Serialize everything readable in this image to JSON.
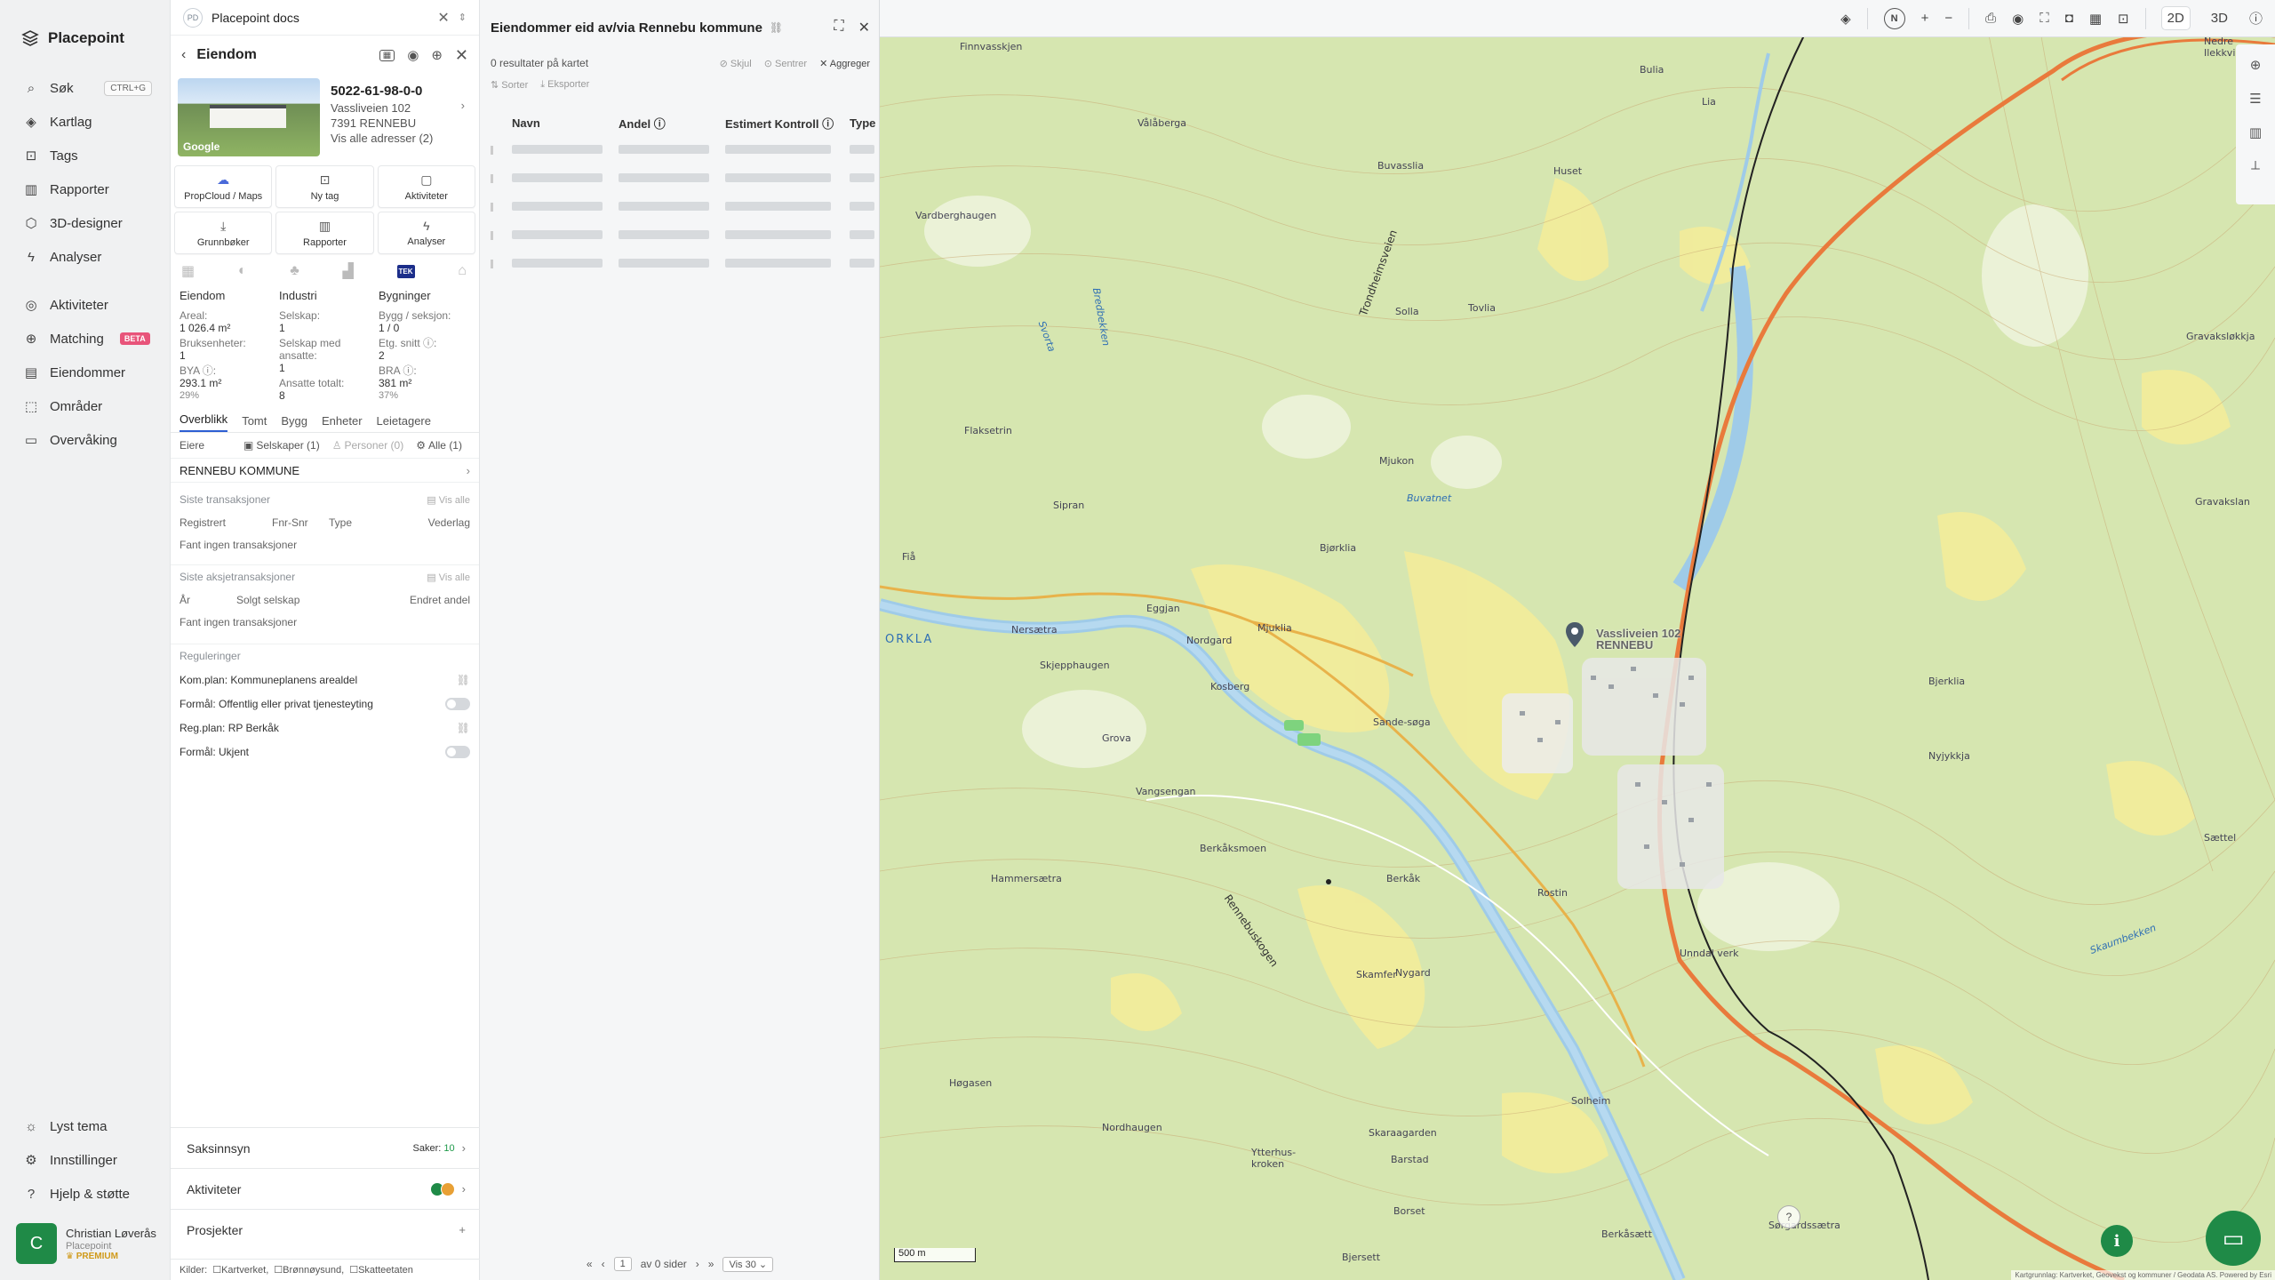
{
  "nav": {
    "brand": "Placepoint",
    "items": [
      {
        "label": "Søk",
        "icon": "search-icon",
        "kbd": "CTRL+G"
      },
      {
        "label": "Kartlag",
        "icon": "layers-icon"
      },
      {
        "label": "Tags",
        "icon": "bookmark-icon"
      },
      {
        "label": "Rapporter",
        "icon": "chart-icon"
      },
      {
        "label": "3D-designer",
        "icon": "cube-icon"
      },
      {
        "label": "Analyser",
        "icon": "bolt-icon"
      },
      {
        "label": "Aktiviteter",
        "icon": "activity-icon"
      },
      {
        "label": "Matching",
        "icon": "match-icon",
        "badge": "BETA"
      },
      {
        "label": "Eiendommer",
        "icon": "building-icon"
      },
      {
        "label": "Områder",
        "icon": "area-icon"
      },
      {
        "label": "Overvåking",
        "icon": "monitor-icon"
      }
    ],
    "bottom": [
      {
        "label": "Lyst tema",
        "icon": "sun-icon"
      },
      {
        "label": "Innstillinger",
        "icon": "gear-icon"
      },
      {
        "label": "Hjelp & støtte",
        "icon": "help-icon"
      }
    ],
    "user": {
      "initial": "C",
      "name": "Christian Løverås",
      "org": "Placepoint",
      "tier": "PREMIUM"
    }
  },
  "panel": {
    "doc_title": "Placepoint docs",
    "doc_badge": "PD",
    "header": "Eiendom",
    "gnr": "5022-61-98-0-0",
    "address": "Vassliveien 102",
    "postal": "7391 RENNEBU",
    "all_addresses": "Vis alle adresser (2)",
    "thumb_logo": "Google",
    "tiles": [
      {
        "label": "PropCloud / Maps",
        "icon": "cloud-icon"
      },
      {
        "label": "Ny tag",
        "icon": "bookmark-icon"
      },
      {
        "label": "Aktiviteter",
        "icon": "chat-icon"
      },
      {
        "label": "Grunnbøker",
        "icon": "download-icon"
      },
      {
        "label": "Rapporter",
        "icon": "chart-icon"
      },
      {
        "label": "Analyser",
        "icon": "bolt-icon"
      }
    ],
    "layer_tek": "TEK",
    "stats": {
      "col1": {
        "title": "Eiendom",
        "areal_l": "Areal:",
        "areal_v": "1 026.4 m²",
        "bruks_l": "Bruksenheter:",
        "bruks_v": "1",
        "bya_l": "BYA ⓘ:",
        "bya_v": "293.1 m²",
        "bya_p": "29%"
      },
      "col2": {
        "title": "Industri",
        "selskap_l": "Selskap:",
        "selskap_v": "1",
        "ansatte_l": "Selskap med ansatte:",
        "ansatte_v": "1",
        "tot_l": "Ansatte totalt:",
        "tot_v": "8"
      },
      "col3": {
        "title": "Bygninger",
        "bygg_l": "Bygg / seksjon:",
        "bygg_v": "1 / 0",
        "etg_l": "Etg. snitt ⓘ:",
        "etg_v": "2",
        "bra_l": "BRA ⓘ:",
        "bra_v": "381 m²",
        "bra_p": "37%"
      }
    },
    "tabs": [
      "Overblikk",
      "Tomt",
      "Bygg",
      "Enheter",
      "Leietagere"
    ],
    "owners": {
      "label": "Eiere",
      "f1": "Selskaper (1)",
      "f2": "Personer (0)",
      "f3": "Alle (1)",
      "owner": "RENNEBU KOMMUNE"
    },
    "transactions": {
      "title": "Siste transaksjoner",
      "show_all": "Vis alle",
      "cols": [
        "Registrert",
        "Fnr-Snr",
        "Type",
        "Vederlag"
      ],
      "empty": "Fant ingen transaksjoner"
    },
    "stock": {
      "title": "Siste aksjetransaksjoner",
      "show_all": "Vis alle",
      "cols": [
        "År",
        "Solgt selskap",
        "Endret andel"
      ],
      "empty": "Fant ingen transaksjoner"
    },
    "regulations": {
      "title": "Reguleringer",
      "items": [
        {
          "label": "Kom.plan: Kommuneplanens arealdel",
          "kind": "link"
        },
        {
          "label": "Formål: Offentlig eller privat tjenesteyting",
          "kind": "toggle"
        },
        {
          "label": "Reg.plan: RP Berkåk",
          "kind": "link"
        },
        {
          "label": "Formål: Ukjent",
          "kind": "toggle"
        }
      ]
    },
    "saksinnsyn": {
      "label": "Saksinnsyn",
      "saker_label": "Saker:",
      "saker_count": "10"
    },
    "aktiviteter": "Aktiviteter",
    "prosjekter": "Prosjekter",
    "sources": {
      "label": "Kilder:",
      "items": [
        "Kartverket,",
        "Brønnøysund,",
        "Skatteetaten"
      ]
    }
  },
  "results": {
    "title": "Eiendommer eid av/via Rennebu kommune",
    "count": "0 resultater på kartet",
    "skjul": "Skjul",
    "sentrer": "Sentrer",
    "aggreger": "Aggreger",
    "sorter": "Sorter",
    "eksporter": "Eksporter",
    "columns": [
      "Navn",
      "Andel ⓘ",
      "Estimert Kontroll ⓘ",
      "Type"
    ],
    "skeleton_rows": 5,
    "pager": {
      "page": "1",
      "of_pages": "av 0 sider",
      "per_page": "Vis 30"
    }
  },
  "map": {
    "mode_2d": "2D",
    "mode_3d": "3D",
    "compass": "N",
    "address_label": "Vassliveien 102",
    "address_sub": "RENNEBU",
    "scale": "500 m",
    "attribution": "Kartgrunnlag: Kartverket, Geovekst og kommuner / Geodata AS. Powered by Esri",
    "places": [
      "Finnvasskjen",
      "Vålåberga",
      "Bulia",
      "Lia",
      "Nedre Ilekkvia",
      "Vardberghaugen",
      "Buvasslia",
      "Huset",
      "Svorta",
      "Bredbekken",
      "Solla",
      "Tovlia",
      "Gravaksløkkja",
      "Flaksetrin",
      "Mjukon",
      "Buvatnet",
      "Gravakslan",
      "Sipran",
      "Fiå",
      "Bjørklia",
      "Nersætra",
      "Skjepphaugen",
      "Eggjan",
      "Mjuklia",
      "Nordgard",
      "Kosberg",
      "Sande-søga",
      "Bjerklia",
      "Grova",
      "Vangsengan",
      "Nyjykkja",
      "Berkåksmoen",
      "Hammersætra",
      "Berkåk",
      "Rostin",
      "Unndal verk",
      "Skamfer",
      "Nygard",
      "Skaumbekken",
      "Høgasen",
      "Nordhaugen",
      "Skaraagarden",
      "Solheim",
      "Barstad",
      "Borset",
      "Sørgardssætra",
      "Berkåsætt",
      "Ytterhus-kroken",
      "Bjersett",
      "Trondheimsveien",
      "Rennebuskogen",
      "ORKLA",
      "Sættel"
    ]
  }
}
